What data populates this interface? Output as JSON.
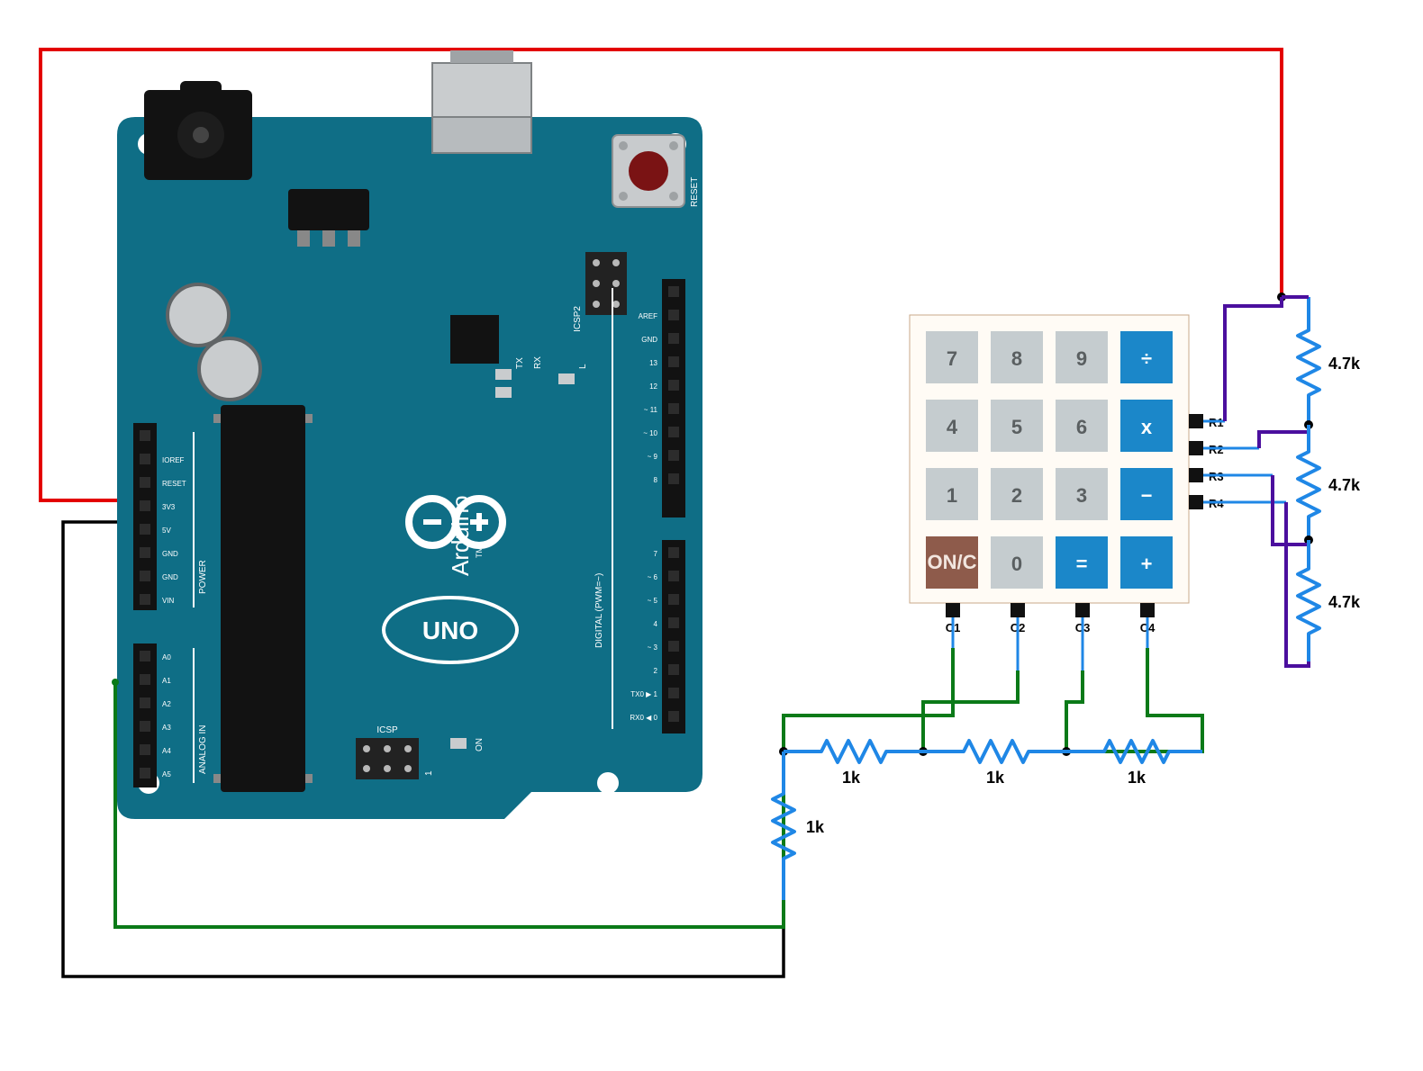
{
  "arduino": {
    "brand": "Arduino",
    "model": "UNO",
    "icsp2": "ICSP2",
    "icsp": "ICSP",
    "tx": "TX",
    "rx": "RX",
    "on": "ON",
    "l": "L",
    "reset_label": "RESET",
    "digital_header": "DIGITAL (PWM=~)",
    "pins_right": [
      "AREF",
      "GND",
      "13",
      "12",
      "~ 11",
      "~ 10",
      "~ 9",
      "8",
      "7",
      "~ 6",
      "~ 5",
      "4",
      "~ 3",
      "2",
      "TX0 ▶ 1",
      "RX0 ◀ 0"
    ],
    "pins_left_power": [
      "IOREF",
      "RESET",
      "3V3",
      "5V",
      "GND",
      "GND",
      "VIN"
    ],
    "pins_left_analog": [
      "A0",
      "A1",
      "A2",
      "A3",
      "A4",
      "A5"
    ],
    "power_group": "POWER",
    "analog_group": "ANALOG IN"
  },
  "keypad": {
    "keys": [
      [
        "7",
        "8",
        "9",
        "÷"
      ],
      [
        "4",
        "5",
        "6",
        "x"
      ],
      [
        "1",
        "2",
        "3",
        "−"
      ],
      [
        "ON/C",
        "0",
        "=",
        "+"
      ]
    ],
    "cols": [
      "C1",
      "C2",
      "C3",
      "C4"
    ],
    "rows": [
      "R1",
      "R2",
      "R3",
      "R4"
    ]
  },
  "resistors": {
    "row_value": "4.7k",
    "col_value": "1k"
  }
}
